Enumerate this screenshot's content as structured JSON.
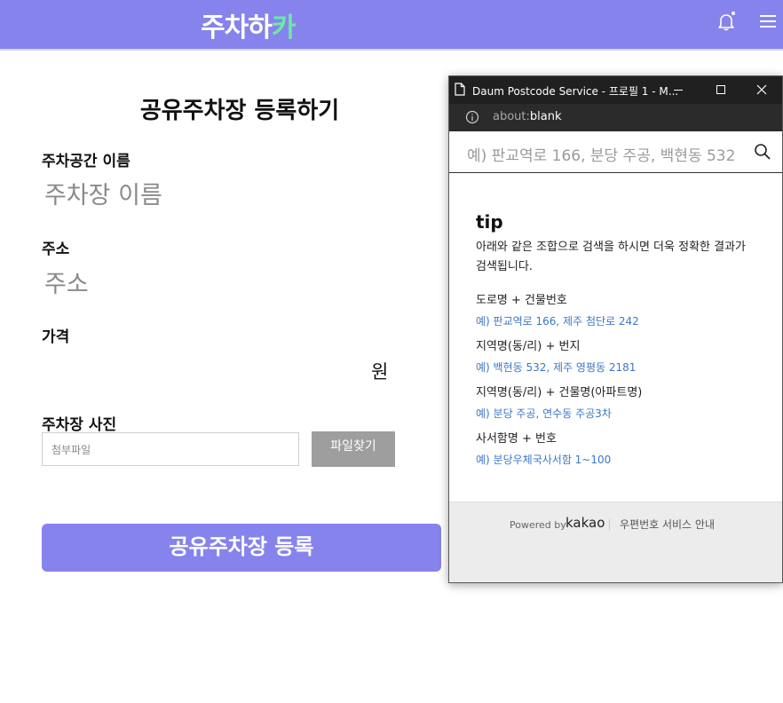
{
  "header": {
    "logo_main": "주차하",
    "logo_accent": "카",
    "icons": [
      "bell-icon",
      "hamburger-menu-icon"
    ],
    "bg_color": "#8683ec",
    "accent_color": "#6ee7a8"
  },
  "form": {
    "title": "공유주차장 등록하기",
    "name_label": "주차공간 이름",
    "name_placeholder": "주차장 이름",
    "address_label": "주소",
    "address_placeholder": "주소",
    "price_label": "가격",
    "price_unit": "원",
    "photo_label": "주차장 사진",
    "file_placeholder": "첨부파일",
    "file_button": "파일찾기",
    "submit_button": "공유주차장 등록"
  },
  "popup": {
    "window_title": "Daum Postcode Service - 프로필 1 - M...",
    "url_prefix": "about:",
    "url_main": "blank",
    "search_placeholder": "예) 판교역로 166, 분당 주공, 백현동 532",
    "tip_title": "tip",
    "tip_desc": "아래와 같은 조합으로 검색을 하시면 더욱 정확한 결과가 검색됩니다.",
    "examples": [
      {
        "head": "도로명 + 건물번호",
        "value": "예) 판교역로 166,  제주 첨단로 242"
      },
      {
        "head": "지역명(동/리) + 번지",
        "value": "예) 백현동 532,  제주 영평동 2181"
      },
      {
        "head": "지역명(동/리) + 건물명(아파트명)",
        "value": "예) 분당 주공,  연수동 주공3차"
      },
      {
        "head": "사서함명 + 번호",
        "value": "예) 분당우체국사서함 1~100"
      }
    ],
    "powered_by": "Powered by",
    "kakao": "kakao",
    "guide_link": "우편번호 서비스 안내"
  }
}
